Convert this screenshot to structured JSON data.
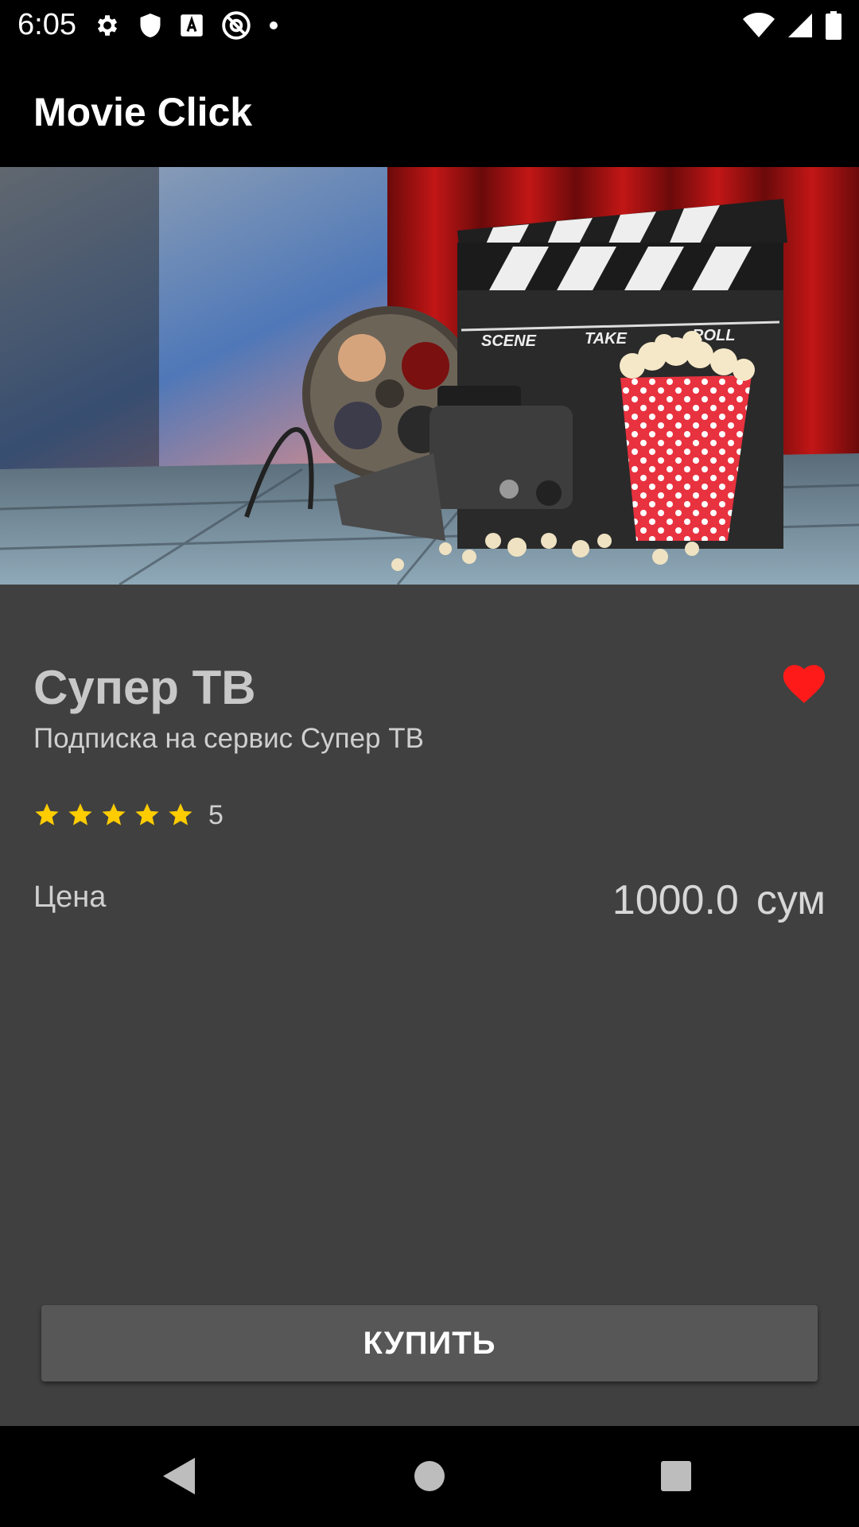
{
  "status_bar": {
    "time": "6:05",
    "left_icons": [
      "gear-icon",
      "shield-icon",
      "font-a-icon",
      "at-circle-icon",
      "dot-icon"
    ],
    "right_icons": [
      "wifi-icon",
      "signal-icon",
      "battery-icon"
    ]
  },
  "app_bar": {
    "title": "Movie Click"
  },
  "hero": {
    "image_description_icons": [
      "clapperboard-icon",
      "film-reel-icon",
      "camera-icon",
      "popcorn-icon"
    ]
  },
  "product": {
    "title": "Супер ТВ",
    "subtitle": "Подписка на сервис Супер ТВ",
    "favorite": true,
    "rating": {
      "stars": 5,
      "max": 5,
      "value_label": "5"
    },
    "price_label": "Цена",
    "price_amount": "1000.0",
    "price_currency": "сум"
  },
  "actions": {
    "buy_label": "КУПИТЬ"
  },
  "nav_bar": {
    "buttons": [
      "back-icon",
      "home-icon",
      "recent-apps-icon"
    ]
  },
  "colors": {
    "background": "#404040",
    "bars": "#000000",
    "accent_heart": "#ff1a1a",
    "star": "#ffcc00",
    "button": "#575757"
  }
}
